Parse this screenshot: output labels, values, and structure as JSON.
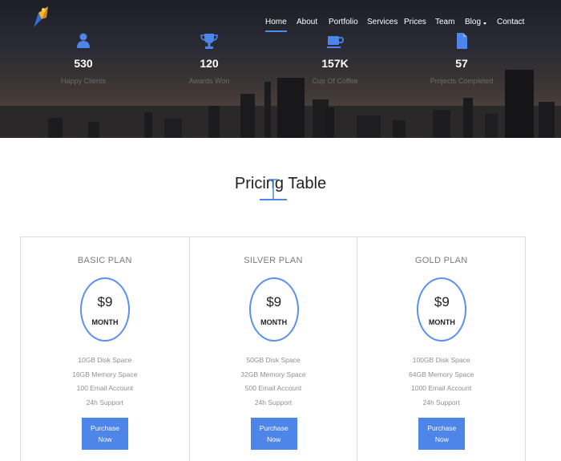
{
  "nav": {
    "items": [
      {
        "label": "Home",
        "active": true
      },
      {
        "label": "About"
      },
      {
        "label": "Portfolio"
      },
      {
        "label": "Services"
      },
      {
        "label": "Prices"
      },
      {
        "label": "Team"
      },
      {
        "label": "Blog",
        "dropdown": true
      },
      {
        "label": "Contact"
      }
    ]
  },
  "stats": [
    {
      "icon": "user-icon",
      "value": "530",
      "label": "Happy Clients"
    },
    {
      "icon": "trophy-icon",
      "value": "120",
      "label": "Awards Won"
    },
    {
      "icon": "coffee-cup-icon",
      "value": "157K",
      "label": "Cup Of Coffee"
    },
    {
      "icon": "document-icon",
      "value": "57",
      "label": "Projects Completed"
    }
  ],
  "pricing": {
    "title": "Pricing Table",
    "plans": [
      {
        "name": "BASIC PLAN",
        "price": "$9",
        "period": "MONTH",
        "features": [
          "10GB Disk Space",
          "16GB Memory Space",
          "100 Email Account",
          "24h Support"
        ],
        "cta_line1": "Purchase",
        "cta_line2": "Now"
      },
      {
        "name": "SILVER PLAN",
        "price": "$9",
        "period": "MONTH",
        "features": [
          "50GB Disk Space",
          "32GB Memory Space",
          "500 Email Account",
          "24h Support"
        ],
        "cta_line1": "Purchase",
        "cta_line2": "Now"
      },
      {
        "name": "GOLD PLAN",
        "price": "$9",
        "period": "MONTH",
        "features": [
          "100GB Disk Space",
          "64GB Memory Space",
          "1000 Email Account",
          "24h Support"
        ],
        "cta_line1": "Purchase",
        "cta_line2": "Now"
      }
    ]
  },
  "colors": {
    "accent": "#4d86e8",
    "circle": "#5b8ff0",
    "hero_dark": "#1d1e27"
  }
}
